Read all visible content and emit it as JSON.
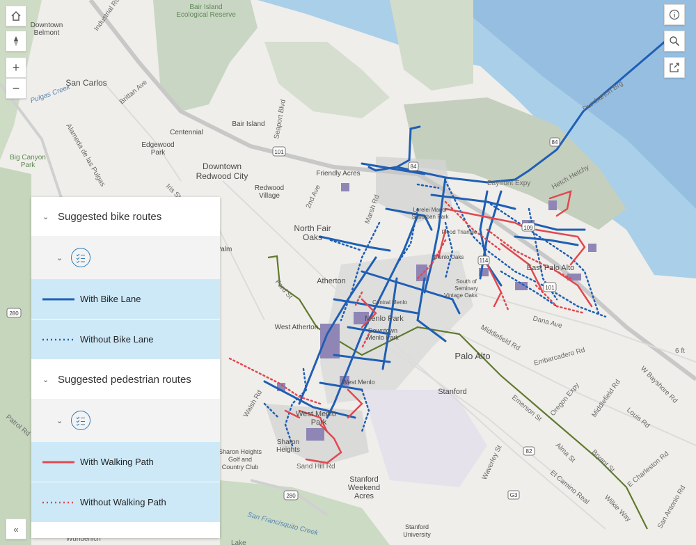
{
  "map": {
    "places": [
      {
        "text": "Downtown"
      },
      {
        "text": "Belmont"
      },
      {
        "text": "San Carlos"
      },
      {
        "text": "Centennial"
      },
      {
        "text": "Edgewood"
      },
      {
        "text": "Park"
      },
      {
        "text": "Big Canyon"
      },
      {
        "text": "Park"
      },
      {
        "text": "Downtown"
      },
      {
        "text": "Redwood City"
      },
      {
        "text": "Redwood"
      },
      {
        "text": "Village"
      },
      {
        "text": "Friendly Acres"
      },
      {
        "text": "North Fair"
      },
      {
        "text": "Oaks"
      },
      {
        "text": "Atherton"
      },
      {
        "text": "West Atherton"
      },
      {
        "text": "Menlo Park"
      },
      {
        "text": "Downtown"
      },
      {
        "text": "Menlo Park"
      },
      {
        "text": "West Menlo"
      },
      {
        "text": "West Menlo"
      },
      {
        "text": "Park"
      },
      {
        "text": "Sharon"
      },
      {
        "text": "Heights"
      },
      {
        "text": "Sharon Heights"
      },
      {
        "text": "Golf and"
      },
      {
        "text": "Country Club"
      },
      {
        "text": "Stanford"
      },
      {
        "text": "Weekend"
      },
      {
        "text": "Acres"
      },
      {
        "text": "Stanford"
      },
      {
        "text": "Stanford"
      },
      {
        "text": "University"
      },
      {
        "text": "Palo Alto"
      },
      {
        "text": "East Palo Alto"
      },
      {
        "text": "Bair Island"
      },
      {
        "text": "Bair Island"
      },
      {
        "text": "Ecological Reserve"
      },
      {
        "text": "Lorelei Manor"
      },
      {
        "text": "Suburban Park"
      },
      {
        "text": "Flood Triangle"
      },
      {
        "text": "Central Menlo"
      },
      {
        "text": "South of"
      },
      {
        "text": "Seminary"
      },
      {
        "text": "Vintage Oaks"
      },
      {
        "text": "Menlo Oaks"
      },
      {
        "text": "Palm"
      }
    ],
    "roads": [
      {
        "text": "Industrial Rd"
      },
      {
        "text": "Brittan Ave"
      },
      {
        "text": "Alameda de las Pulgas"
      },
      {
        "text": "Seaport Blvd"
      },
      {
        "text": "2nd Ave"
      },
      {
        "text": "Marsh Rd"
      },
      {
        "text": "Iris St"
      },
      {
        "text": "Dumbarton Brg"
      },
      {
        "text": "Bayfront Expy"
      },
      {
        "text": "Middlefield Rd"
      },
      {
        "text": "Embarcadero Rd"
      },
      {
        "text": "Emerson St"
      },
      {
        "text": "Oregon Expy"
      },
      {
        "text": "Alma St"
      },
      {
        "text": "El Camino Real"
      },
      {
        "text": "Dana Ave"
      },
      {
        "text": "Louis Rd"
      },
      {
        "text": "W Bayshore Rd"
      },
      {
        "text": "E Charleston Rd"
      },
      {
        "text": "San Antonio Rd"
      },
      {
        "text": "Middlefield Rd"
      },
      {
        "text": "Sand Hill Rd"
      },
      {
        "text": "Walsh Rd"
      },
      {
        "text": "Bryant St"
      },
      {
        "text": "Waverley St"
      },
      {
        "text": "Wilkie Way"
      },
      {
        "text": "Patrol Rd"
      },
      {
        "text": "Pulgas Creek"
      },
      {
        "text": "San Francisquito Creek"
      },
      {
        "text": "Hetch Hetchy"
      },
      {
        "text": "Ford St"
      },
      {
        "text": "6 ft"
      },
      {
        "text": "Wunderlich"
      },
      {
        "text": "Lake"
      }
    ],
    "shields": [
      {
        "text": "101"
      },
      {
        "text": "84"
      },
      {
        "text": "84"
      },
      {
        "text": "114"
      },
      {
        "text": "109"
      },
      {
        "text": "101"
      },
      {
        "text": "82"
      },
      {
        "text": "280"
      },
      {
        "text": "280"
      },
      {
        "text": "G3"
      }
    ]
  },
  "legend": {
    "groups": [
      {
        "title": "Suggested bike routes",
        "items": [
          {
            "label": "With Bike Lane",
            "color": "#1f5fb4",
            "style": "solid"
          },
          {
            "label": "Without Bike Lane",
            "color": "#1f5fb4",
            "style": "dotted"
          }
        ]
      },
      {
        "title": "Suggested pedestrian routes",
        "items": [
          {
            "label": "With Walking Path",
            "color": "#e04850",
            "style": "solid"
          },
          {
            "label": "Without Walking Path",
            "color": "#e04850",
            "style": "dotted"
          }
        ]
      }
    ]
  },
  "controls": {
    "home": "home-icon",
    "compass": "compass-icon",
    "zoom_in": "+",
    "zoom_out": "−",
    "info": "info-icon",
    "search": "search-icon",
    "share": "share-icon",
    "collapse": "«"
  },
  "colors": {
    "water": "#a9cfe9",
    "bay": "#8fb6dc",
    "marsh": "#c9d6c4",
    "bike": "#1f5fb4",
    "ped": "#e04850",
    "trail": "#5f7a2e",
    "purple": "#8f86b6"
  }
}
